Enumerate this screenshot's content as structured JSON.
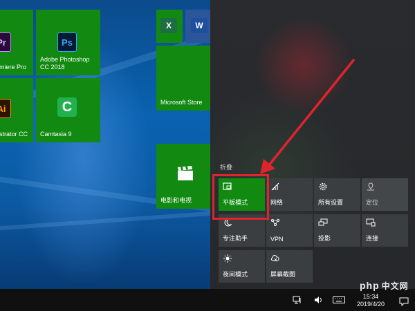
{
  "start_tiles": {
    "premiere": {
      "label": "emiere Pro",
      "icon": "Pr"
    },
    "photoshop": {
      "label": "Adobe Photoshop\nCC 2018",
      "icon": "Ps"
    },
    "illustrator": {
      "label": "ustrator CC",
      "icon": "Ai"
    },
    "camtasia": {
      "label": "Camtasia 9",
      "icon": "C"
    },
    "excel": {
      "icon": "X"
    },
    "word": {
      "icon": "W"
    },
    "store": {
      "label": "Microsoft Store"
    },
    "movies": {
      "label": "电影和电视"
    }
  },
  "action_center": {
    "collapse_label": "折叠",
    "quick_actions": [
      {
        "label": "平板模式",
        "icon": "tablet-mode-icon",
        "state": "on"
      },
      {
        "label": "网络",
        "icon": "network-icon",
        "state": "off"
      },
      {
        "label": "所有设置",
        "icon": "settings-icon",
        "state": "off"
      },
      {
        "label": "定位",
        "icon": "location-icon",
        "state": "disabled"
      },
      {
        "label": "专注助手",
        "icon": "moon-icon",
        "state": "off"
      },
      {
        "label": "VPN",
        "icon": "vpn-icon",
        "state": "off"
      },
      {
        "label": "投影",
        "icon": "project-icon",
        "state": "off"
      },
      {
        "label": "连接",
        "icon": "connect-icon",
        "state": "off"
      },
      {
        "label": "夜间模式",
        "icon": "night-light-icon",
        "state": "off"
      },
      {
        "label": "屏幕截图",
        "icon": "screen-snip-icon",
        "state": "off"
      }
    ]
  },
  "taskbar": {
    "time": "15:34",
    "date": "2019/4/20",
    "tray_icons": [
      "network-tray-icon",
      "volume-icon",
      "keyboard-icon",
      "notification-icon"
    ]
  },
  "watermark": {
    "text": "php",
    "cn": "中文网"
  },
  "colors": {
    "accent": "#128a12",
    "highlight": "#e0242d",
    "tile_inactive": "#3b3e41"
  }
}
